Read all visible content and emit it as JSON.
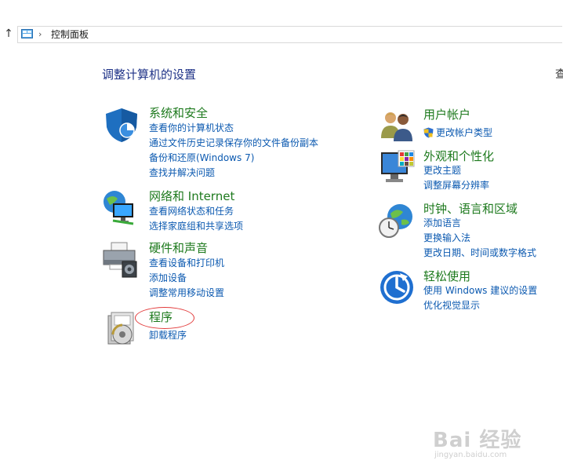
{
  "address": {
    "path": "控制面板"
  },
  "main": {
    "heading": "调整计算机的设置",
    "cut_off_text": "查"
  },
  "categories": [
    {
      "title": "系统和安全",
      "links": [
        "查看你的计算机状态",
        "通过文件历史记录保存你的文件备份副本",
        "备份和还原(Windows 7)",
        "查找并解决问题"
      ]
    },
    {
      "title": "网络和 Internet",
      "links": [
        "查看网络状态和任务",
        "选择家庭组和共享选项"
      ]
    },
    {
      "title": "硬件和声音",
      "links": [
        "查看设备和打印机",
        "添加设备",
        "调整常用移动设置"
      ]
    },
    {
      "title": "程序",
      "links": [
        "卸载程序"
      ]
    },
    {
      "title": "用户帐户",
      "links": [
        "更改帐户类型"
      ]
    },
    {
      "title": "外观和个性化",
      "links": [
        "更改主题",
        "调整屏幕分辨率"
      ]
    },
    {
      "title": "时钟、语言和区域",
      "links": [
        "添加语言",
        "更换输入法",
        "更改日期、时间或数字格式"
      ]
    },
    {
      "title": "轻松使用",
      "links": [
        "使用 Windows 建议的设置",
        "优化视觉显示"
      ]
    }
  ],
  "watermark": {
    "brand": "Bai 经验",
    "url": "jingyan.baidu.com"
  },
  "colors": {
    "title": "#1e7a1e",
    "link": "#0b59b0",
    "heading": "#1e3287",
    "annotation": "#e23b3b"
  }
}
